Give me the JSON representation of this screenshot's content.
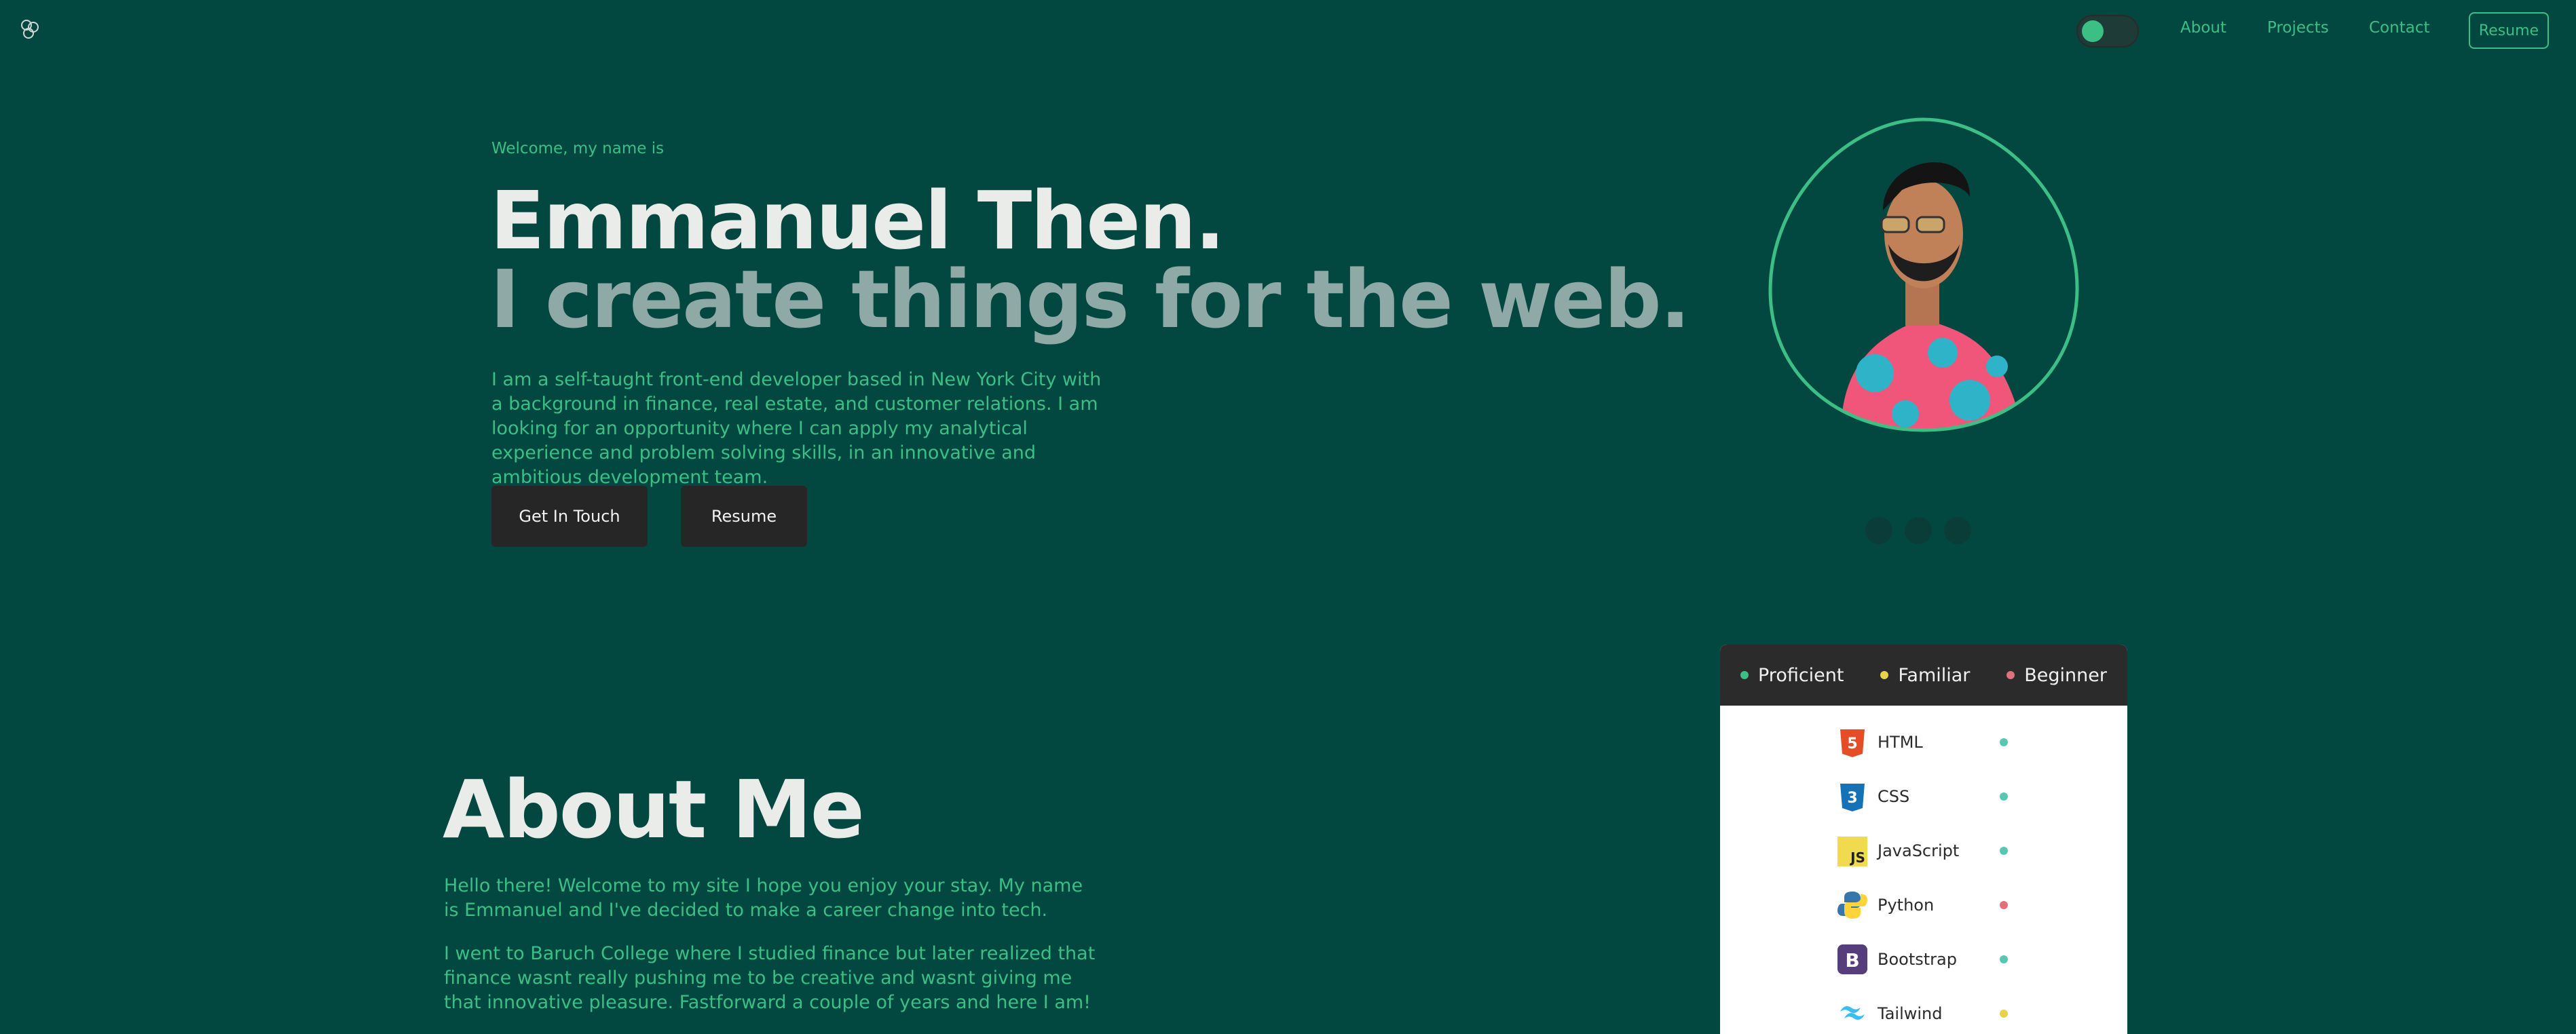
{
  "nav": {
    "links": [
      "About",
      "Projects",
      "Contact"
    ],
    "resume_label": "Resume"
  },
  "hero": {
    "welcome": "Welcome, my name is",
    "name": "Emmanuel Then.",
    "tagline": "I create things for the web.",
    "intro": "I am a self-taught front-end developer based in New York City with a background in finance, real estate, and customer relations. I am looking for an opportunity where I can apply my analytical experience and problem solving skills, in an innovative and ambitious development team.",
    "buttons": {
      "touch": "Get In Touch",
      "resume": "Resume"
    }
  },
  "about": {
    "title": "About Me",
    "paragraph1": "Hello there! Welcome to my site I hope you enjoy your stay. My name is Emmanuel and I've decided to make a career change into tech.",
    "paragraph2": "I went to Baruch College where I studied finance but later realized that finance wasnt really pushing me to be creative and wasnt giving me that innovative pleasure. Fastforward a couple of years and here I am!"
  },
  "skills": {
    "legend": [
      {
        "label": "Proficient",
        "color": "#3bbf85"
      },
      {
        "label": "Familiar",
        "color": "#e8d24a"
      },
      {
        "label": "Beginner",
        "color": "#e0707a"
      }
    ],
    "items": [
      {
        "label": "HTML",
        "level": "Proficient",
        "color": "#58c7b0",
        "icon": "html5-icon"
      },
      {
        "label": "CSS",
        "level": "Proficient",
        "color": "#58c7b0",
        "icon": "css3-icon"
      },
      {
        "label": "JavaScript",
        "level": "Proficient",
        "color": "#58c7b0",
        "icon": "javascript-icon"
      },
      {
        "label": "Python",
        "level": "Beginner",
        "color": "#e0707a",
        "icon": "python-icon"
      },
      {
        "label": "Bootstrap",
        "level": "Proficient",
        "color": "#58c7b0",
        "icon": "bootstrap-icon"
      },
      {
        "label": "Tailwind",
        "level": "Familiar",
        "color": "#e8d24a",
        "icon": "tailwind-icon"
      }
    ]
  },
  "colors": {
    "background": "#034741",
    "accent": "#3bbf85",
    "muted_heading": "#8ea9a6",
    "button_bg": "#262626"
  }
}
